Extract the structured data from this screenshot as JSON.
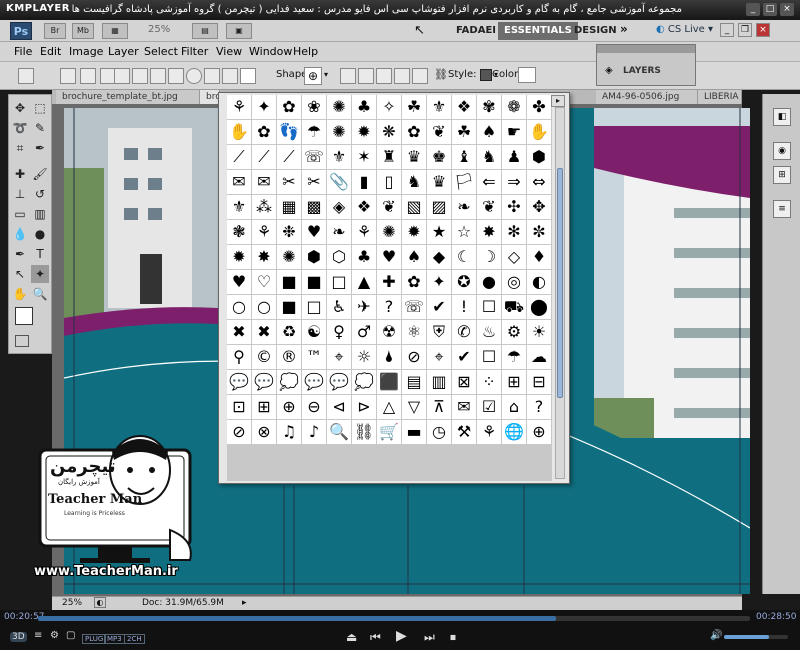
{
  "player": {
    "logo": "KMPLAYER",
    "caption": "مجموعه آموزشی جامع ، گام به گام و کاربردی نرم افزار فتوشاپ سی اس فایو  مدرس : سعید فدایی ( تیچرمن ) گروه آموزشی پادشاه گرافیست ها",
    "time_elapsed": "00:20:57",
    "time_total": "00:28:50",
    "progress": 0.727,
    "volume": 0.7,
    "badges": [
      "PLUG",
      "MP3",
      "2CH"
    ],
    "icons": [
      "3d-icon",
      "stop-icon",
      "prev-icon",
      "play-icon",
      "next-icon",
      "eject-icon",
      "volume-icon"
    ]
  },
  "appbar": {
    "logo": "Ps",
    "zoom": "25%",
    "workspaces": [
      "FADAEI",
      "ESSENTIALS",
      "DESIGN"
    ],
    "cs_live": "CS Live"
  },
  "menus": [
    "File",
    "Edit",
    "Image",
    "Layer",
    "Select",
    "Filter",
    "View",
    "Window",
    "Help"
  ],
  "options": {
    "shape_label": "Shape:",
    "style_label": "Style:",
    "color_label": "Color:"
  },
  "tabs": [
    "brochure_template_bt.jpg",
    "bro",
    "AM4-96-0506.jpg",
    "LIBERIA"
  ],
  "layers_panel": {
    "label": "LAYERS"
  },
  "status": {
    "zoom": "25%",
    "doc": "Doc: 31.9M/65.9M"
  },
  "shapes": [
    "⚘",
    "✦",
    "✿",
    "❀",
    "✺",
    "♣",
    "✧",
    "☘",
    "⚜",
    "❖",
    "✾",
    "❁",
    "✤",
    "✋",
    "✿",
    "👣",
    "☂",
    "✺",
    "✹",
    "❋",
    "✿",
    "❦",
    "☘",
    "♠",
    "☛",
    "✋",
    "⟋",
    "⟋",
    "⟋",
    "☏",
    "⚜",
    "✶",
    "♜",
    "♛",
    "♚",
    "♝",
    "♞",
    "♟",
    "⬢",
    "✉",
    "✉",
    "✂",
    "✂",
    "📎",
    "▮",
    "▯",
    "♞",
    "♛",
    "🏳",
    "⇐",
    "⇒",
    "⇔",
    "⚜",
    "⁂",
    "▦",
    "▩",
    "◈",
    "❖",
    "❦",
    "▧",
    "▨",
    "❧",
    "❦",
    "✣",
    "✥",
    "❃",
    "⚘",
    "❉",
    "♥",
    "❧",
    "⚘",
    "✺",
    "✹",
    "★",
    "☆",
    "✸",
    "✻",
    "✼",
    "✹",
    "✸",
    "✺",
    "⬢",
    "⬡",
    "♣",
    "♥",
    "♠",
    "◆",
    "☾",
    "☽",
    "◇",
    "♦",
    "♥",
    "♡",
    "■",
    "■",
    "□",
    "▲",
    "✚",
    "✿",
    "✦",
    "✪",
    "●",
    "◎",
    "◐",
    "○",
    "○",
    "■",
    "□",
    "♿",
    "✈",
    "?",
    "☏",
    "✔",
    "!",
    "☐",
    "⛟",
    "⬤",
    "✖",
    "✖",
    "♻",
    "☯",
    "♀",
    "♂",
    "☢",
    "⚛",
    "⛨",
    "✆",
    "♨",
    "⚙",
    "☀",
    "⚲",
    "©",
    "®",
    "™",
    "⌖",
    "☼",
    "🌢",
    "⊘",
    "⌖",
    "✔",
    "☐",
    "☂",
    "☁",
    "💬",
    "💬",
    "💭",
    "💬",
    "💬",
    "💭",
    "⬛",
    "▤",
    "▥",
    "⊠",
    "⁘",
    "⊞",
    "⊟",
    "⊡",
    "⊞",
    "⊕",
    "⊖",
    "⊲",
    "⊳",
    "△",
    "▽",
    "⊼",
    "✉",
    "☑",
    "⌂",
    "?",
    "⊘",
    "⊗",
    "♫",
    "♪",
    "🔍",
    "⛓",
    "🛒",
    "▬",
    "◷",
    "⚒",
    "⚘",
    "🌐",
    "⊕"
  ],
  "watermark": {
    "brand_fa": "تیچرمن",
    "subtitle": "آموزش رایگان",
    "name": "Teacher Man",
    "tagline": "Learning is Priceless",
    "url": "www.TeacherMan.ir"
  }
}
